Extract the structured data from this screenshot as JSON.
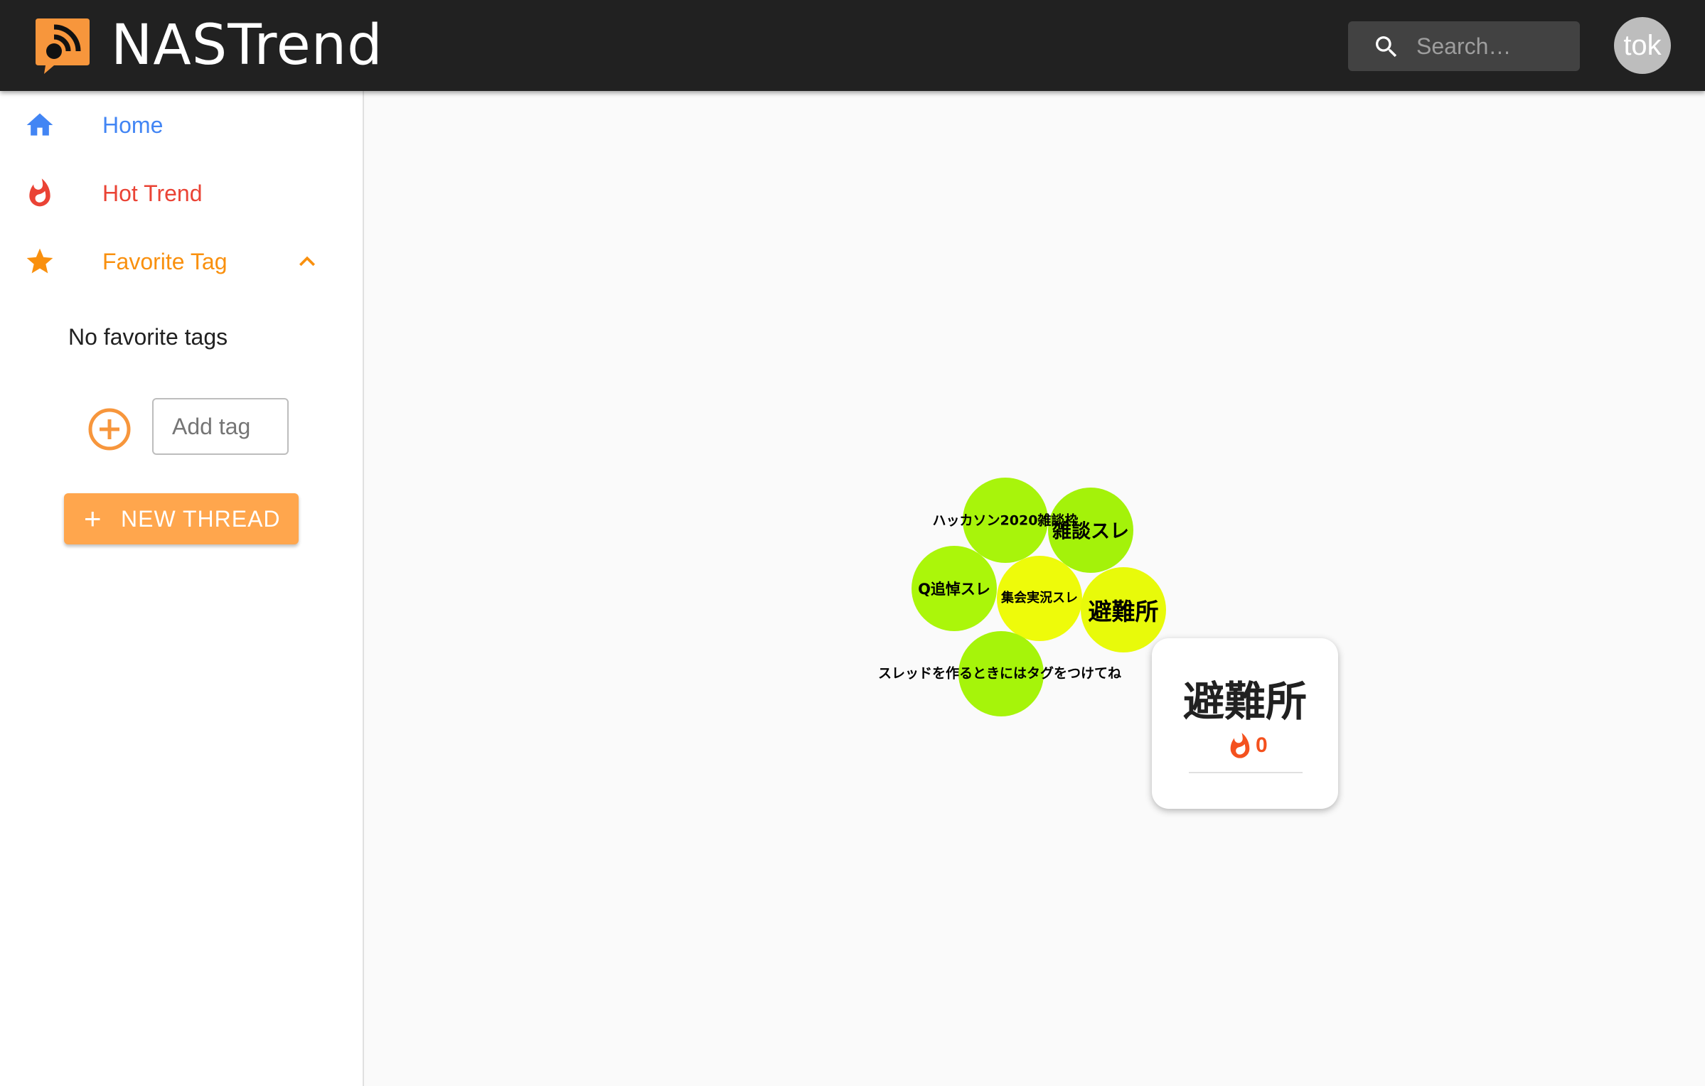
{
  "app": {
    "title": "NASTrend",
    "logo_icon": "rss-chat-icon",
    "accent": "#f7963c"
  },
  "search": {
    "placeholder": "Search…"
  },
  "user": {
    "avatar_text": "tok"
  },
  "drawer": {
    "nav": [
      {
        "label": "Home",
        "icon": "home-icon",
        "color": "#4285f4"
      },
      {
        "label": "Hot Trend",
        "icon": "fire-icon",
        "color": "#ea4335"
      },
      {
        "label": "Favorite Tag",
        "icon": "star-icon",
        "color": "#f9900e"
      }
    ],
    "favorites_empty": "No favorite tags",
    "add_tag_placeholder": "Add tag",
    "new_thread_label": "NEW THREAD"
  },
  "bubbles": [
    {
      "label": "ハッカソン2020雑談枠",
      "color": "#a8f40b"
    },
    {
      "label": "雑談スレ",
      "color": "#a4f20a"
    },
    {
      "label": "Q追悼スレ",
      "color": "#abf60a"
    },
    {
      "label": "集会実況スレ",
      "color": "#eefb0a"
    },
    {
      "label": "避難所",
      "color": "#e8fa0a"
    },
    {
      "label": "スレッドを作るときにはタグをつけてね",
      "color": "#a6f40a"
    }
  ],
  "tooltip": {
    "title": "避難所",
    "count": "0",
    "icon": "fire-icon"
  }
}
